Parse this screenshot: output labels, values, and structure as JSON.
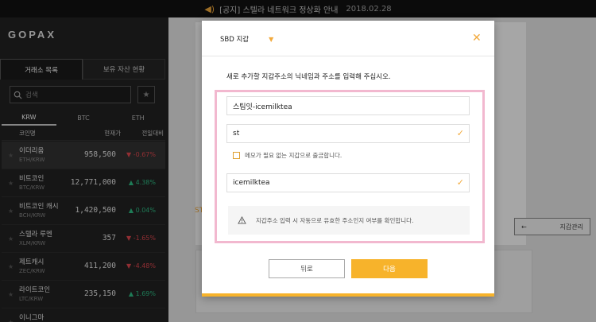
{
  "notice": {
    "text": "[공지] 스텔라 네트워크 정상화 안내",
    "date": "2018.02.28"
  },
  "sidebar": {
    "logo": "GOPAX",
    "tabs": [
      "거래소 목록",
      "보유 자산 현황"
    ],
    "search_placeholder": "검색",
    "currency_tabs": [
      "KRW",
      "BTC",
      "ETH"
    ],
    "columns": [
      "코인명",
      "현재가",
      "전일대비"
    ],
    "coins": [
      {
        "name": "이더리움",
        "pair": "ETH/KRW",
        "price": "958,500",
        "change": "▼ -0.67%",
        "dir": "down"
      },
      {
        "name": "비트코인",
        "pair": "BTC/KRW",
        "price": "12,771,000",
        "change": "▲ 4.38%",
        "dir": "up"
      },
      {
        "name": "비트코인 캐시",
        "pair": "BCH/KRW",
        "price": "1,420,500",
        "change": "▲ 0.04%",
        "dir": "up"
      },
      {
        "name": "스텔라 루멘",
        "pair": "XLM/KRW",
        "price": "357",
        "change": "▼ -1.65%",
        "dir": "down"
      },
      {
        "name": "제트캐시",
        "pair": "ZEC/KRW",
        "price": "411,200",
        "change": "▼ -4.48%",
        "dir": "down"
      },
      {
        "name": "라이트코인",
        "pair": "LTC/KRW",
        "price": "235,150",
        "change": "▲ 1.69%",
        "dir": "up"
      },
      {
        "name": "이니그마",
        "pair": "",
        "price": "",
        "change": "",
        "dir": "up"
      }
    ]
  },
  "background": {
    "st_label": "ST",
    "wallet_button": "지갑관리",
    "wallet_arrow": "←"
  },
  "modal": {
    "title": "SBD 지갑",
    "caret": "▼",
    "close": "✕",
    "instruction": "새로 추가할 지갑주소의 닉네임과 주소를 입력해 주십시오.",
    "nickname_value": "스팀잇-icemilktea",
    "address_value": "st",
    "memo_label": "메모가 필요 없는 지갑으로 출금합니다.",
    "memo_value": "icemilktea",
    "warning": "지갑주소 입력 시 자동으로 유효한 주소인지 여부를 확인합니다.",
    "back_button": "뒤로",
    "next_button": "다음"
  },
  "colors": {
    "accent": "#f7b32b",
    "highlight": "#f2b8cf",
    "up": "#2ebd85",
    "down": "#e0484f"
  }
}
